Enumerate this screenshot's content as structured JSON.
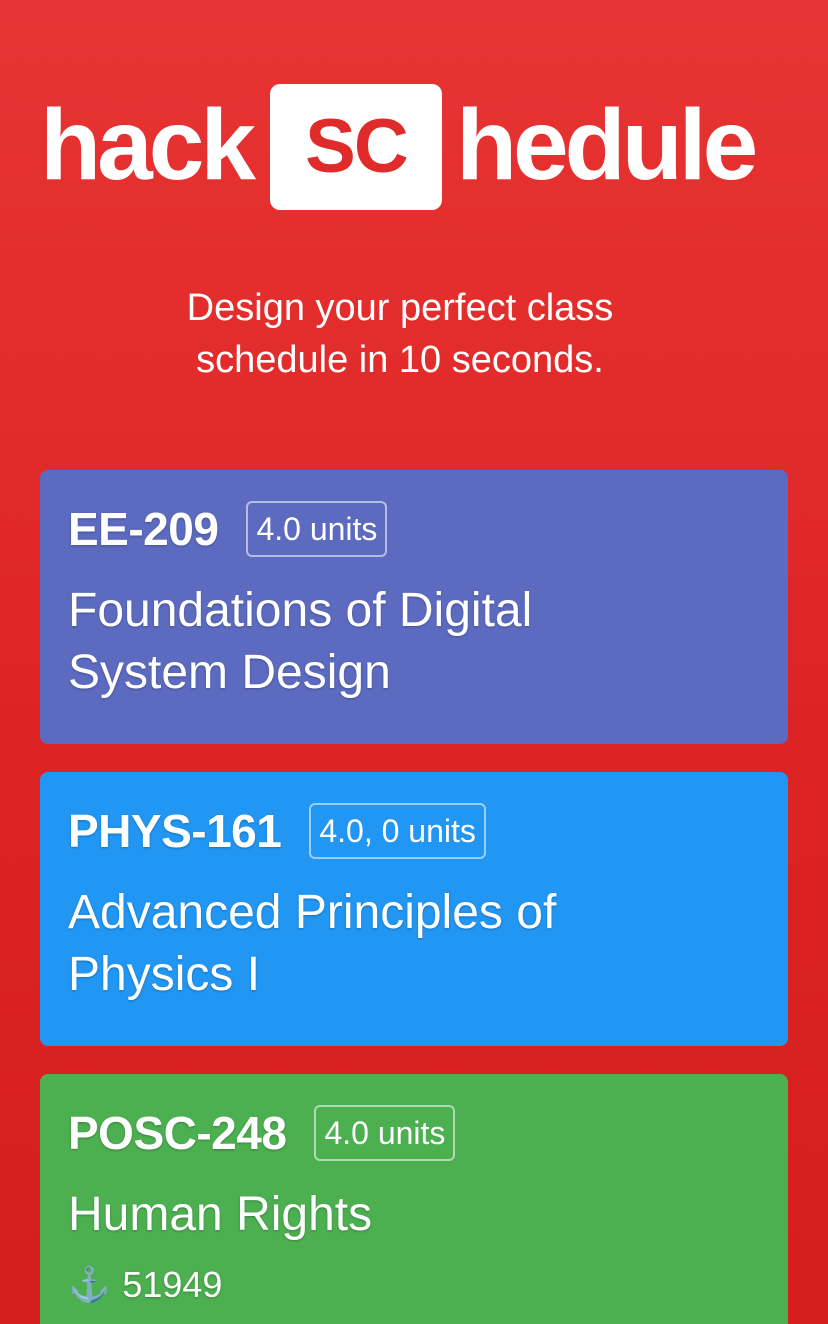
{
  "logo": {
    "left_word": "hack",
    "box_word": "SC",
    "right_word": "hedule"
  },
  "tagline": {
    "line1": "Design your perfect class",
    "line2": "schedule in 10 seconds."
  },
  "courses": [
    {
      "code": "EE-209",
      "units": "4.0 units",
      "title_line1": "Foundations of Digital",
      "title_line2": "System Design",
      "color": "#5c6bc0"
    },
    {
      "code": "PHYS-161",
      "units": "4.0, 0 units",
      "title_line1": "Advanced Principles of",
      "title_line2": "Physics I",
      "color": "#2196f3"
    },
    {
      "code": "POSC-248",
      "units": "4.0 units",
      "title_line1": "Human Rights",
      "section_icon": "anchor-icon",
      "section_number": "51949",
      "color": "#4caf50"
    }
  ]
}
